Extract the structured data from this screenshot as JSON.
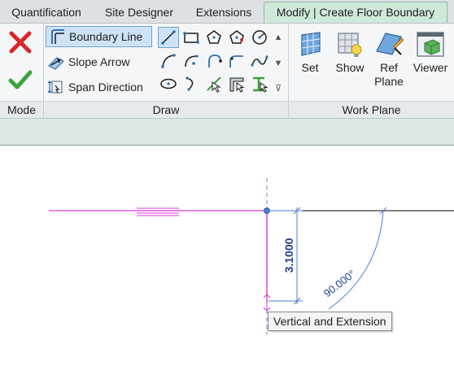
{
  "tabs": [
    {
      "label": "Quantification",
      "active": false
    },
    {
      "label": "Site Designer",
      "active": false
    },
    {
      "label": "Extensions",
      "active": false
    },
    {
      "label": "Modify | Create Floor Boundary",
      "active": true
    }
  ],
  "ribbon": {
    "mode": {
      "label": "Mode",
      "finish_icon": "green-checkmark-icon",
      "cancel_icon": "red-x-icon"
    },
    "draw": {
      "label": "Draw",
      "items": [
        {
          "label": "Boundary Line",
          "icon": "boundary-line-icon",
          "selected": true
        },
        {
          "label": "Slope Arrow",
          "icon": "slope-arrow-icon",
          "selected": false
        },
        {
          "label": "Span Direction",
          "icon": "span-direction-icon",
          "selected": false
        }
      ],
      "tools": [
        "line-icon",
        "rectangle-icon",
        "inscribed-polygon-icon",
        "circumscribed-polygon-icon",
        "circle-icon",
        "start-end-arc-icon",
        "center-end-arc-icon",
        "tangent-arc-icon",
        "fillet-arc-icon",
        "spline-icon",
        "ellipse-icon",
        "partial-ellipse-icon",
        "pick-lines-icon",
        "pick-walls-icon",
        "pick-supports-icon"
      ]
    },
    "work_plane": {
      "label": "Work Plane",
      "buttons": [
        {
          "label": "Set",
          "icon": "set-work-plane-icon"
        },
        {
          "label": "Show",
          "icon": "show-work-plane-icon"
        },
        {
          "label": "Ref Plane",
          "icon": "ref-plane-icon"
        },
        {
          "label": "Viewer",
          "icon": "viewer-icon"
        }
      ]
    }
  },
  "canvas": {
    "dimension_value": "3.1000",
    "angle_value": "90.000°",
    "tooltip": "Vertical and Extension",
    "colors": {
      "boundary_line": "#d63bd6",
      "dimension": "#4a7fd4",
      "dimension_text": "#1f3f8f",
      "wall_line": "#000000",
      "extension_guide": "#5b8fd9"
    }
  }
}
